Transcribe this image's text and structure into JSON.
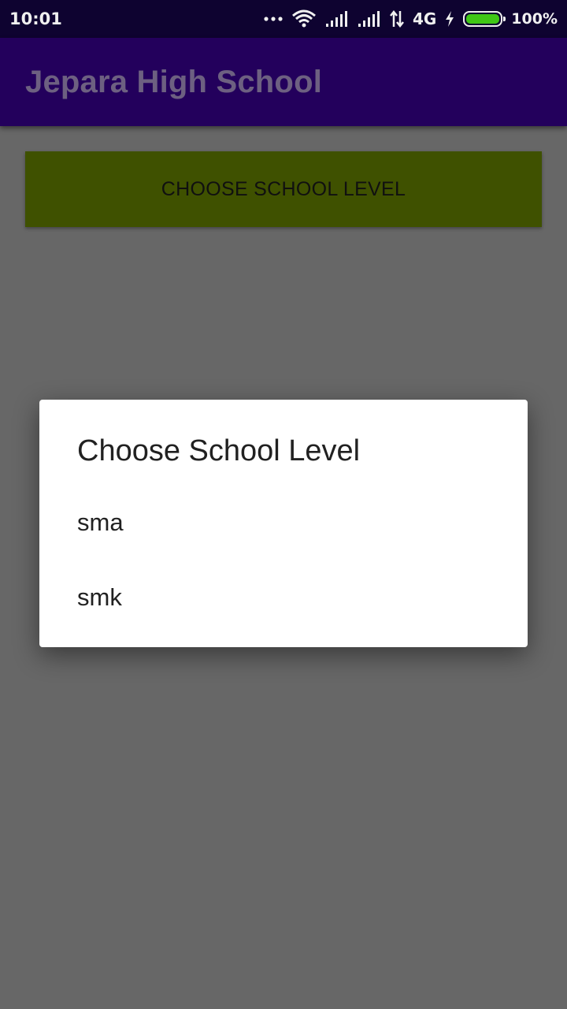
{
  "status_bar": {
    "time": "10:01",
    "network": "4G",
    "battery_percent": "100%",
    "battery_level": 1.0,
    "battery_color": "#3fc716",
    "icons": [
      "more-dots-icon",
      "wifi-icon",
      "signal-icon",
      "signal-icon",
      "data-transfer-icon",
      "charging-icon",
      "battery-icon"
    ]
  },
  "app_bar": {
    "title": "Jepara High School",
    "background": "#23005c"
  },
  "main": {
    "choose_button_label": "CHOOSE SCHOOL LEVEL",
    "choose_button_color": "#3f5100"
  },
  "dialog": {
    "title": "Choose School Level",
    "items": [
      {
        "label": "sma"
      },
      {
        "label": "smk"
      }
    ]
  }
}
